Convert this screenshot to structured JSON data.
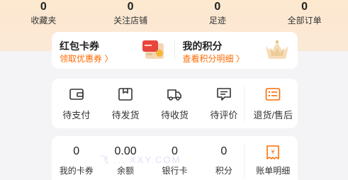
{
  "stats": [
    {
      "value": "0",
      "label": "收藏夹"
    },
    {
      "value": "0",
      "label": "关注店铺"
    },
    {
      "value": "0",
      "label": "足迹"
    },
    {
      "value": "0",
      "label": "全部订单"
    }
  ],
  "promo": {
    "left": {
      "title": "红包卡券",
      "link": "领取优惠券 〉",
      "icon": "red-packet-icon"
    },
    "right": {
      "title": "我的积分",
      "link": "查看积分明细 〉",
      "icon": "crown-icon"
    }
  },
  "orders": [
    {
      "label": "待支付",
      "icon": "wallet-icon"
    },
    {
      "label": "待发货",
      "icon": "box-icon"
    },
    {
      "label": "待收货",
      "icon": "truck-icon"
    },
    {
      "label": "待评价",
      "icon": "comment-icon"
    },
    {
      "label": "退货/售后",
      "icon": "list-icon"
    }
  ],
  "wallet": [
    {
      "value": "0",
      "label": "我的卡券"
    },
    {
      "value": "0.00",
      "label": "余额"
    },
    {
      "value": "0",
      "label": "银行卡"
    },
    {
      "value": "0",
      "label": "积分"
    },
    {
      "label": "账单明细",
      "icon": "bill-icon"
    }
  ],
  "watermark": "飞 ... XXY.COM",
  "colors": {
    "accent": "#ff6a00",
    "top_bg": "#fde8cf"
  }
}
